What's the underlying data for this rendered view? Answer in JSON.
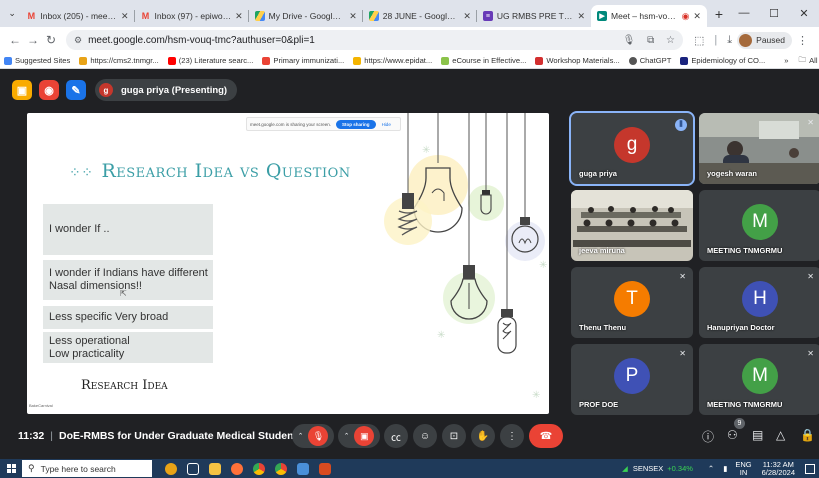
{
  "browser": {
    "tabs": [
      {
        "label": "Inbox (205) - meeting@tn",
        "favicon": "gmail-icon",
        "color": "#ea4335"
      },
      {
        "label": "Inbox (97) - epiworkshop@",
        "favicon": "gmail-icon",
        "color": "#ea4335"
      },
      {
        "label": "My Drive - Google Drive",
        "favicon": "drive-icon",
        "color": "#1fa463"
      },
      {
        "label": "28 JUNE - Google Drive",
        "favicon": "drive-icon",
        "color": "#1fa463"
      },
      {
        "label": "UG RMBS PRE TEST 28/06/",
        "favicon": "forms-icon",
        "color": "#673ab7"
      },
      {
        "label": "Meet – hsm-vouq-tmc",
        "favicon": "meet-icon",
        "color": "#00897b",
        "active": true
      }
    ],
    "url": "meet.google.com/hsm-vouq-tmc?authuser=0&pli=1",
    "profile_label": "Paused",
    "bookmarks": [
      {
        "label": "Suggested Sites",
        "color": "#4285f4"
      },
      {
        "label": "https://cms2.tnmgr...",
        "color": "#e8a317"
      },
      {
        "label": "(23) Literature searc...",
        "color": "#ff0000"
      },
      {
        "label": "Primary immunizati...",
        "color": "#ea4335"
      },
      {
        "label": "https://www.epidat...",
        "color": "#f4b400"
      },
      {
        "label": "eCourse in Effective...",
        "color": "#8bc34a"
      },
      {
        "label": "Workshop Materials...",
        "color": "#d32f2f"
      },
      {
        "label": "ChatGPT",
        "color": "#555555"
      },
      {
        "label": "Epidemiology of CO...",
        "color": "#1a237e"
      }
    ],
    "bookmarks_overflow": "»",
    "all_bookmarks": "All Bookmarks"
  },
  "meet": {
    "presenter_initial": "g",
    "presenter_label": "guga priya (Presenting)",
    "share_bar": {
      "text": "meet.google.com is sharing your screen.",
      "stop_label": "Stop sharing",
      "hide_label": "Hide"
    },
    "slide": {
      "title": "Research Idea vs Question",
      "boxes": [
        {
          "lines": [
            "I wonder If .."
          ]
        },
        {
          "lines": [
            "I wonder if Indians have different",
            "Nasal dimensions!!"
          ]
        },
        {
          "lines": [
            "Less specific Very broad"
          ]
        },
        {
          "lines": [
            "Less operational",
            "Low practicality"
          ]
        }
      ],
      "footer": "Research Idea",
      "signature": "BakeCarnival"
    },
    "participants": [
      {
        "name": "guga priya",
        "initial": "g",
        "color": "#c5372c",
        "speaking": true
      },
      {
        "name": "yogesh waran",
        "photo": true
      },
      {
        "name": "jeeva miruna",
        "photo": true
      },
      {
        "name": "MEETING TNMGRMU",
        "initial": "M",
        "color": "#43a047"
      },
      {
        "name": "Thenu Thenu",
        "initial": "T",
        "color": "#f57c00",
        "muted": true
      },
      {
        "name": "Hanupriyan Doctor",
        "initial": "H",
        "color": "#3f51b5",
        "muted": true
      },
      {
        "name": "PROF DOE",
        "initial": "P",
        "color": "#3f51b5",
        "muted": true
      },
      {
        "name": "MEETING TNMGRMU",
        "initial": "M",
        "color": "#43a047",
        "muted": true
      }
    ],
    "time": "11:32",
    "meeting_title": "DoE-RMBS for Under Graduate Medical Students",
    "people_count": "9"
  },
  "taskbar": {
    "search_placeholder": "Type here to search",
    "ticker": "SENSEX",
    "ticker_change": "+0.34%",
    "lang_top": "ENG",
    "lang_bottom": "IN",
    "time": "11:32 AM",
    "date": "6/28/2024"
  }
}
